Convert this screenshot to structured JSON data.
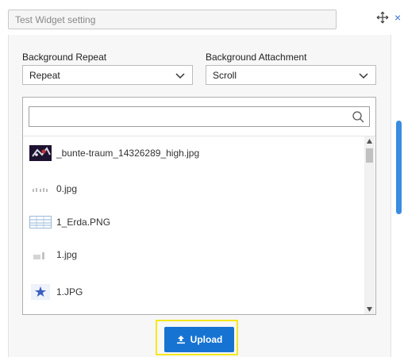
{
  "header": {
    "title_placeholder": "Test Widget setting",
    "close_glyph": "×"
  },
  "settings": {
    "repeat_label": "Background Repeat",
    "repeat_value": "Repeat",
    "attachment_label": "Background Attachment",
    "attachment_value": "Scroll"
  },
  "picker": {
    "search_value": "",
    "files": [
      {
        "name": "_bunte-traum_14326289_high.jpg",
        "thumb": "photo-thumb"
      },
      {
        "name": "0.jpg",
        "thumb": "grey-thumb"
      },
      {
        "name": "1_Erda.PNG",
        "thumb": "table-thumb"
      },
      {
        "name": "1.jpg",
        "thumb": "grey-thumb"
      },
      {
        "name": "1.JPG",
        "thumb": "star-thumb"
      }
    ]
  },
  "actions": {
    "upload_label": "Upload"
  },
  "colors": {
    "accent": "#1773d2",
    "highlight": "#f5e71e",
    "scroll_thumb": "#3a8de0"
  }
}
